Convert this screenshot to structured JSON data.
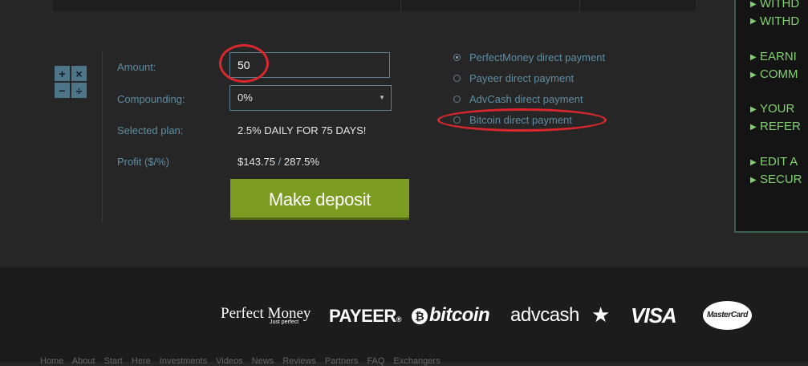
{
  "calculator": {
    "icon_symbols": [
      "+",
      "×",
      "−",
      "÷"
    ],
    "amount_label": "Amount:",
    "amount_value": "50",
    "compounding_label": "Compounding:",
    "compounding_value": "0%",
    "selected_plan_label": "Selected plan:",
    "selected_plan_value": "2.5% DAILY FOR 75 DAYS!",
    "profit_label": "Profit ($/%)",
    "profit_dollar": "$143.75",
    "profit_separator": "/",
    "profit_percent": "287.5%",
    "deposit_button": "Make deposit"
  },
  "payment_methods": [
    {
      "label": "PerfectMoney direct payment",
      "selected": true
    },
    {
      "label": "Payeer direct payment",
      "selected": false
    },
    {
      "label": "AdvCash direct payment",
      "selected": false
    },
    {
      "label": "Bitcoin direct payment",
      "selected": false
    }
  ],
  "side_menu": {
    "items": [
      "WITHD",
      "WITHD",
      "EARNI",
      "COMM",
      "YOUR",
      "REFER",
      "EDIT A",
      "SECUR"
    ]
  },
  "footer": {
    "logos": {
      "perfect_money": "Perfect Money",
      "perfect_money_sub": "Just perfect",
      "payeer": "PAYEER",
      "payeer_mark": "®",
      "bitcoin_symbol": "₿",
      "bitcoin": "bitcoin",
      "advcash": "advcash",
      "advcash_star": "★",
      "visa": "VISA",
      "mastercard": "MasterCard"
    },
    "links_text": "Home About Start Here Investments Videos News Reviews Partners FAQ Exchangers"
  },
  "colors": {
    "accent_green": "#7d9c22",
    "label_blue": "#5f8ea3",
    "annotation_red": "#d9272e",
    "menu_green": "#82d070"
  }
}
